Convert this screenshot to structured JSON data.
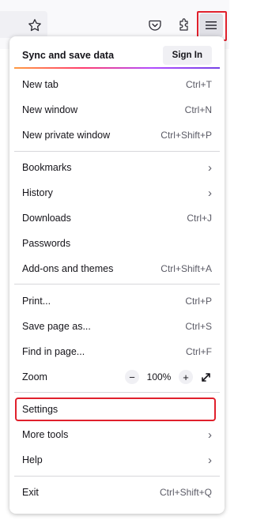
{
  "toolbar": {
    "icons": [
      "star-icon",
      "pocket-icon",
      "extensions-icon",
      "hamburger-menu-icon"
    ]
  },
  "annotation_color": "#e0202c",
  "menu": {
    "sync": {
      "label": "Sync and save data",
      "button": "Sign In"
    },
    "new_tab": {
      "label": "New tab",
      "shortcut": "Ctrl+T"
    },
    "new_window": {
      "label": "New window",
      "shortcut": "Ctrl+N"
    },
    "new_private_window": {
      "label": "New private window",
      "shortcut": "Ctrl+Shift+P"
    },
    "bookmarks": {
      "label": "Bookmarks"
    },
    "history": {
      "label": "History"
    },
    "downloads": {
      "label": "Downloads",
      "shortcut": "Ctrl+J"
    },
    "passwords": {
      "label": "Passwords"
    },
    "addons": {
      "label": "Add-ons and themes",
      "shortcut": "Ctrl+Shift+A"
    },
    "print": {
      "label": "Print...",
      "shortcut": "Ctrl+P"
    },
    "save_page": {
      "label": "Save page as...",
      "shortcut": "Ctrl+S"
    },
    "find": {
      "label": "Find in page...",
      "shortcut": "Ctrl+F"
    },
    "zoom": {
      "label": "Zoom",
      "minus": "−",
      "value": "100%",
      "plus": "+"
    },
    "settings": {
      "label": "Settings"
    },
    "more_tools": {
      "label": "More tools"
    },
    "help": {
      "label": "Help"
    },
    "exit": {
      "label": "Exit",
      "shortcut": "Ctrl+Shift+Q"
    }
  }
}
